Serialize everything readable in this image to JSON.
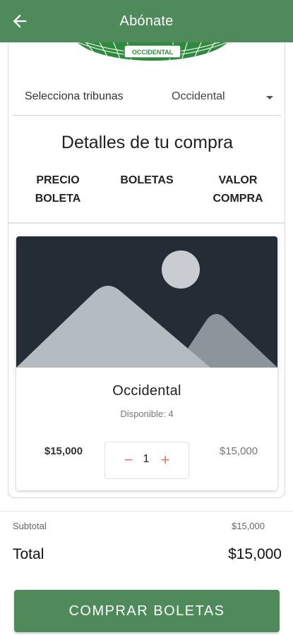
{
  "appbar": {
    "title": "Abónate"
  },
  "stadium": {
    "label": "OCCIDENTAL"
  },
  "tribuna": {
    "label": "Selecciona tribunas",
    "selected": "Occidental"
  },
  "details": {
    "title": "Detalles de tu compra",
    "col_price": "PRECIO BOLETA",
    "col_qty": "BOLETAS",
    "col_value_line1": "VALOR",
    "col_value_line2": "COMPRA"
  },
  "card": {
    "name": "Occidental",
    "available": "Disponible: 4",
    "price": "$15,000",
    "quantity": "1",
    "minus": "−",
    "plus": "+",
    "total": "$15,000"
  },
  "summary": {
    "subtotal_label": "Subtotal",
    "subtotal_value": "$15,000",
    "total_label": "Total",
    "total_value": "$15,000"
  },
  "buy_button": {
    "label": "COMPRAR BOLETAS"
  },
  "colors": {
    "primary": "#4e8a5a",
    "accent": "#e57373",
    "placeholder_bg": "#242c36"
  },
  "icons": {
    "back": "arrow-left",
    "image_placeholder": "mountain-sun"
  }
}
